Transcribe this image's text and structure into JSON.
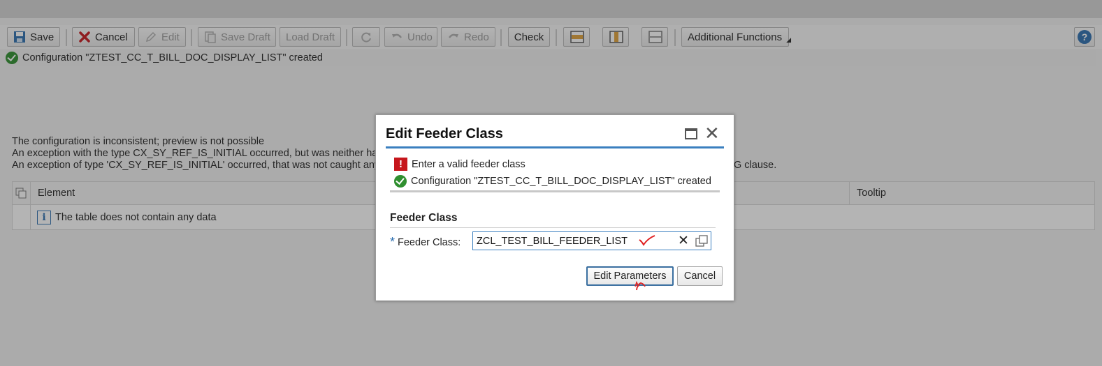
{
  "toolbar": {
    "save": "Save",
    "cancel": "Cancel",
    "edit": "Edit",
    "save_draft": "Save Draft",
    "load_draft": "Load Draft",
    "undo": "Undo",
    "redo": "Redo",
    "check": "Check",
    "additional_functions": "Additional Functions",
    "help": "?"
  },
  "message_bar": {
    "text": "Configuration \"ZTEST_CC_T_BILL_DOC_DISPLAY_LIST\" created"
  },
  "errors": {
    "line1": "The configuration is inconsistent; preview is not possible",
    "line2": "An exception with the type CX_SY_REF_IS_INITIAL occurred, but was neither har",
    "line3": "An exception of type 'CX_SY_REF_IS_INITIAL' occurred, that was not caught any",
    "line3_tail": "G clause."
  },
  "table": {
    "col_element": "Element",
    "col_tooltip": "Tooltip",
    "empty_text": "The table does not contain any data"
  },
  "dialog": {
    "title": "Edit Feeder Class",
    "msg_error": "Enter a valid feeder class",
    "msg_success": "Configuration \"ZTEST_CC_T_BILL_DOC_DISPLAY_LIST\" created",
    "section_title": "Feeder Class",
    "field_label": "Feeder Class:",
    "required_marker": "*",
    "field_value": "ZCL_TEST_BILL_FEEDER_LIST",
    "edit_parameters": "Edit Parameters",
    "cancel": "Cancel"
  },
  "colors": {
    "accent": "#3a7fbf",
    "error": "#c6161c",
    "success": "#2f8f2f",
    "annotation": "#e02020"
  }
}
